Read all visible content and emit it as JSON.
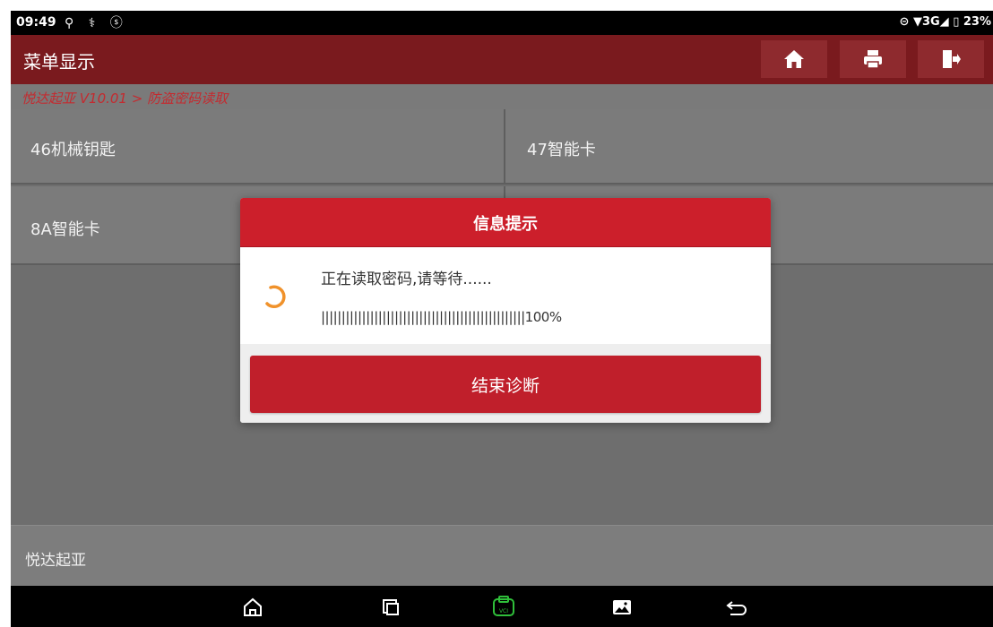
{
  "status_bar": {
    "time": "09:49",
    "left_icons": "⚲ ⚕ ⓢ",
    "right_text": "⊝ ▼3G◢ ▯ 23%"
  },
  "app_bar": {
    "title": "菜单显示",
    "buttons": [
      "home-icon",
      "print-icon",
      "exit-icon"
    ]
  },
  "breadcrumb": "悦达起亚 V10.01 > 防盗密码读取",
  "menu": {
    "items": [
      {
        "label": "46机械钥匙"
      },
      {
        "label": "47智能卡"
      },
      {
        "label": "8A智能卡"
      },
      {
        "label": ""
      }
    ]
  },
  "footer": {
    "label": "悦达起亚"
  },
  "dialog": {
    "title": "信息提示",
    "message": "正在读取密码,请等待......",
    "progress_text": "||||||||||||||||||||||||||||||||||||||||||||||||||100%",
    "progress_value": 100,
    "button_label": "结束诊断",
    "accent_color": "#c01f2b",
    "spinner_color": "#f0922b"
  },
  "nav_bar": {
    "icons": [
      "home-icon",
      "recent-apps-icon",
      "vci-icon",
      "gallery-icon",
      "back-icon"
    ]
  }
}
